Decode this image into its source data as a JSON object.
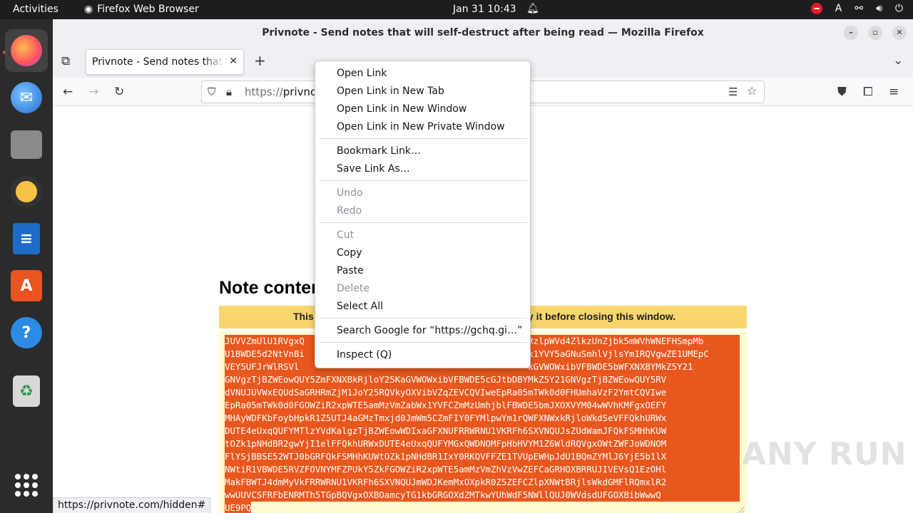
{
  "topbar": {
    "activities": "Activities",
    "app_name": "Firefox Web Browser",
    "clock": "Jan 31  10:43",
    "input_indicator": "A"
  },
  "dock": {
    "items": [
      {
        "name": "Firefox",
        "icon": "firefox-icon",
        "color": "#ff7139"
      },
      {
        "name": "Thunderbird",
        "icon": "thunderbird-icon",
        "color": "#1f6fd1"
      },
      {
        "name": "Files",
        "icon": "files-icon",
        "color": "#787878"
      },
      {
        "name": "Rhythmbox",
        "icon": "rhythmbox-icon",
        "color": "#f6c244"
      },
      {
        "name": "LibreOffice Writer",
        "icon": "writer-icon",
        "color": "#1c6cc8"
      },
      {
        "name": "Ubuntu Software",
        "icon": "software-icon",
        "color": "#e95420"
      },
      {
        "name": "Help",
        "icon": "help-icon",
        "color": "#2d8be6"
      },
      {
        "name": "Trash",
        "icon": "trash-icon",
        "color": "#cccccc"
      }
    ],
    "apps_grid_icon": "apps-grid-icon"
  },
  "window": {
    "title": "Privnote - Send notes that will self-destruct after being read — Mozilla Firefox"
  },
  "tab": {
    "title": "Privnote - Send notes that will self-destruct after being read"
  },
  "urlbar": {
    "scheme": "https://",
    "host_visible": "privno"
  },
  "page": {
    "heading": "Note conten",
    "warning_left": "This",
    "warning_right": "y it before closing this window.",
    "note_lines": [
      "JUVVZmUlU1RVgxQ                                          RzlpWVd4ZlkzUnZjbk5mWVhWNEFHSmpMb",
      "U1BWDE5d2NtVnBi                                          k1YVY5aGNuSmhlVjlsYm1RQVgwZE1UMEpC",
      "VEY5UFJrWlRSVl                                           kGVWOWxibVFBWDE5bWFXNXBYMkZ5Y21",
      "GNVgzTjBZWEowQUY5ZmFXNXBkRjloY25KaGVWOWxibVFBWDE5cGJtbDBYMkZ5Y21GNVgzTjBZWEowQUY5RV",
      "dVNUJUVWxEQUdSaGRHRmZjM1JoY25RQVkyOXVibVZqZEVCQVIweEpRa05mTWk0d0FHUmhaVzF2YmtCQVIwe",
      "EpRa05mTWk0d0FGOWZiR2xpWTE5amMzVmZabWx1YVFCZmMzUmhjblFBWDE5bmJXOXVYM04wWVhKMFgxOEFY",
      "MHAyWDFKbFoybHpkR1Z5UTJ4aGMzTmxjd0JmWm5CZmFIY0FYMlpwYm1rQWFXNWxkRjloWkdSeVFFQkhURWx",
      "DUTE4eUxqQUFYMTlzYVdKalgzTjBZWEowWDIxaGFXNUFRRWRNU1VKRFh6SXVNQUJsZUdWamJFQkFSMHhKUW",
      "tOZk1pNHdBR2gwYjI1elFFQkhURWxDUTE4eUxqQUFYMGxQWDNOMFpHbHVYM1Z6WldRQVgxOWtZWFJoWDNOM",
      "FlYSjBBSE52WTJ0bGRFQkFSMHhKUWtOZk1pNHdBR1IxY0RKQVFFZE1TVUpEWHpJdU1BQmZYMlJ6YjE5b1lX",
      "NWtiR1VBWDE5RVZFOVNYMFZPUkY5ZkFGOWZiR2xpWTE5amMzVmZhVzVwZEFCaGRHOXBRRUJIVEVsQ1EzOHl",
      "MakFBWTJ4dmMyVkFRRWRNU1VKRFh6SXVNQUJmWDJKemMxOXpkR0Z5ZEFCZlpXNWtBRjlsWkdGMFlRQmxlR2",
      "wwUUVCSFRFbENRMTh5TGpBQVgxOXBOamcyTG1kbGRGOXdZMTkwYUhWdF5NWllQUJ0WVdsdUFGOXBibWwwQ",
      "UE9PQ"
    ]
  },
  "statusbar": {
    "url": "https://privnote.com/hidden#"
  },
  "watermark": "ANY RUN",
  "context_menu": {
    "items": [
      {
        "label": "Open Link",
        "enabled": true
      },
      {
        "label": "Open Link in New Tab",
        "enabled": true
      },
      {
        "label": "Open Link in New Window",
        "enabled": true
      },
      {
        "label": "Open Link in New Private Window",
        "enabled": true
      },
      {
        "label": "Bookmark Link…",
        "enabled": true
      },
      {
        "label": "Save Link As…",
        "enabled": true
      },
      {
        "label": "Undo",
        "enabled": false
      },
      {
        "label": "Redo",
        "enabled": false
      },
      {
        "label": "Cut",
        "enabled": false
      },
      {
        "label": "Copy",
        "enabled": true
      },
      {
        "label": "Paste",
        "enabled": true
      },
      {
        "label": "Delete",
        "enabled": false
      },
      {
        "label": "Select All",
        "enabled": true
      },
      {
        "label": "Search Google for “https://gchq.gi…”",
        "enabled": true
      },
      {
        "label": "Inspect (Q)",
        "enabled": true
      }
    ]
  },
  "colors": {
    "selection": "#e8571e",
    "warning": "#f8d66d",
    "note_background": "#fffbd0",
    "topbar": "#1d1d1d",
    "dock": "#2b2b2b"
  }
}
